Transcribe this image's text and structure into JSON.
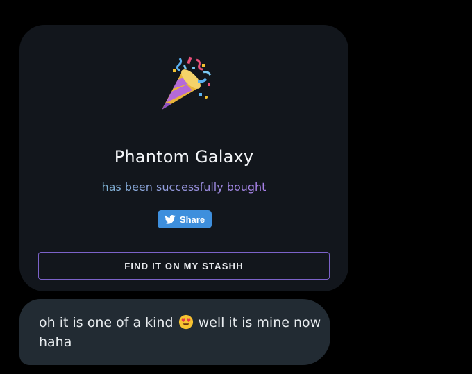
{
  "card": {
    "icon": "party-popper-icon",
    "title": "Phantom Galaxy",
    "subtitle": "has been successfully bought",
    "share_label": "Share",
    "share_icon": "twitter-bird-icon",
    "find_label": "FIND IT ON MY STASHH"
  },
  "message": {
    "text_before": "oh it is one of a kind",
    "emoji": "heart-eyes-emoji-icon",
    "text_after": "well it is mine now haha"
  },
  "colors": {
    "background": "#000000",
    "card": "#12161c",
    "share_button": "#3e8fdd",
    "find_border": "#7b62c9",
    "bubble": "#222b33"
  }
}
